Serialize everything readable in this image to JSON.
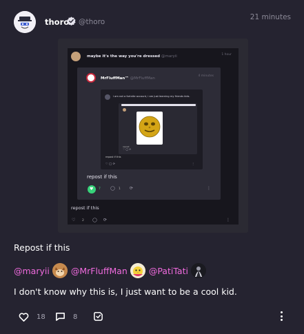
{
  "post": {
    "author": {
      "name": "thoro",
      "handle": "@thoro",
      "verified": true,
      "avatar_icon": "ghost-avatar-icon"
    },
    "timestamp": "21 minutes",
    "text_line_1": "Repost if this",
    "mentions": [
      {
        "text": "@maryii",
        "avatar_icon": "fox-avatar-icon"
      },
      {
        "text": "@MrFluffMan",
        "avatar_icon": "chick-avatar-icon"
      },
      {
        "text": "@PatiTati",
        "avatar_icon": "dark-figure-avatar-icon"
      }
    ],
    "text_line_3": "I don't know why this is, I just want to be a cool kid.",
    "actions": {
      "like_count": "18",
      "reply_count": "8"
    }
  },
  "embedded": {
    "outer_title": "maybe it's the way you're dressed",
    "outer_handle": "@maryii",
    "outer_time": "1 hour",
    "second_title": "MrFluffMan™",
    "second_handle": "@MrFluffMan",
    "second_time": "4 minutes",
    "third_text": "i am not a fortnite account, i am just learning my friends kids.",
    "third_footer": "repost if this",
    "second_repost_text": "repost if this",
    "second_like_count": "7",
    "second_reply_count": "1",
    "outer_repost_text": "repost if this",
    "outer_like_count": "2"
  },
  "colors": {
    "background": "#252330",
    "mention": "#f06bde",
    "muted": "#8c8a98",
    "like_green": "#37d37a"
  }
}
